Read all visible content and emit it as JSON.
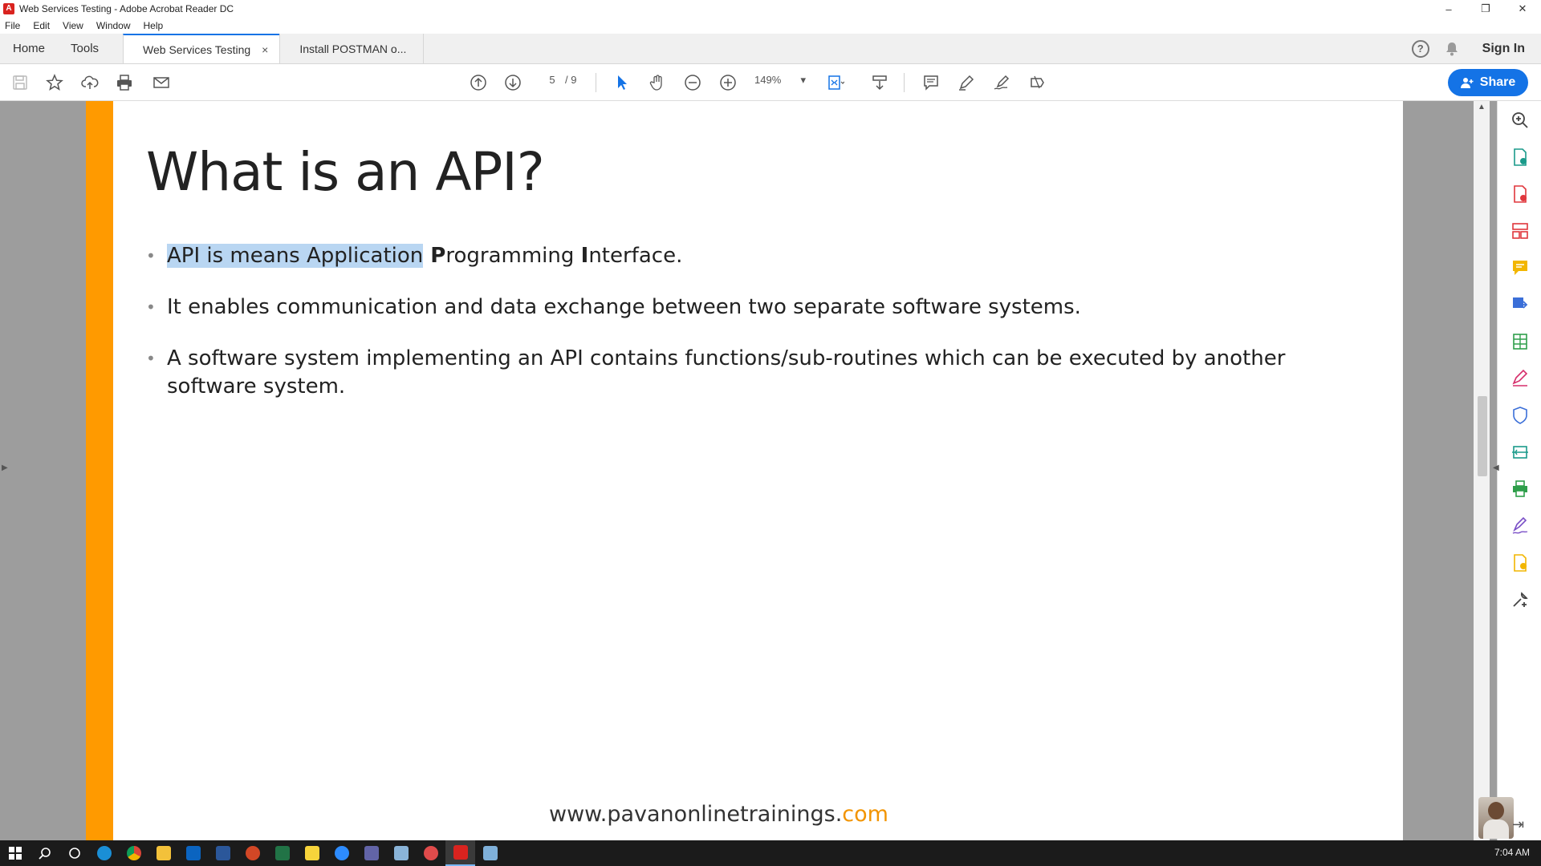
{
  "window": {
    "title": "Web Services Testing - Adobe Acrobat Reader DC",
    "app_icon_glyph": "A",
    "controls": [
      "–",
      "❐",
      "✕"
    ]
  },
  "menu": [
    "File",
    "Edit",
    "View",
    "Window",
    "Help"
  ],
  "tabs": {
    "home": "Home",
    "tools": "Tools",
    "doc_active": "Web Services Testing",
    "doc_inactive": "Install POSTMAN o...",
    "close_glyph": "×",
    "help_glyph": "?",
    "sign_in": "Sign In"
  },
  "toolbar": {
    "page_current": "5",
    "page_total": "/ 9",
    "zoom": "149%",
    "zoom_caret": "▾",
    "share": "Share"
  },
  "slide": {
    "title": "What is an API?",
    "bullet1": {
      "highlighted": "API is means Application",
      "rest_p": " P",
      "rest_1": "rogramming ",
      "rest_i": "I",
      "rest_2": "nterface."
    },
    "bullet2": "It enables communication and data exchange between two separate software systems.",
    "bullet3": "A software system implementing an API contains functions/sub-routines which can be executed by another software system.",
    "footer_main": "www.pavanonlinetrainings.",
    "footer_com": "com"
  },
  "taskbar": {
    "clock": "7:04 AM"
  },
  "colors": {
    "accent_orange": "#ff9a00",
    "acrobat_blue": "#1473e6",
    "highlight": "#b9d6f2",
    "acrobat_red": "#d9231f"
  }
}
